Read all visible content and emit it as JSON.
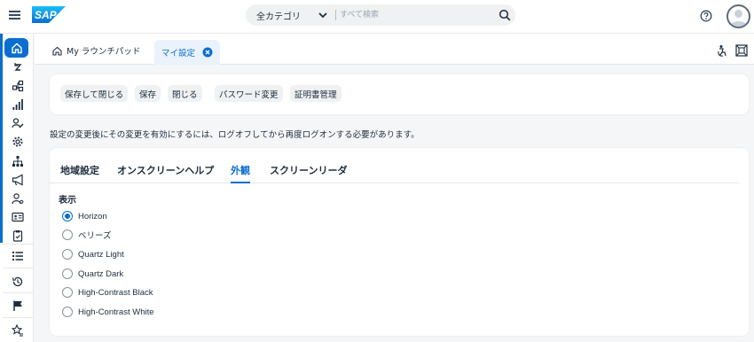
{
  "header": {
    "logo_text": "SAP",
    "search": {
      "category": "全カテゴリ",
      "placeholder": "すべて検索"
    }
  },
  "tabs": {
    "launchpad": "My ラウンチパッド",
    "settings": "マイ設定"
  },
  "toolbar": {
    "save_close": "保存して閉じる",
    "save": "保存",
    "close": "閉じる",
    "change_password": "パスワード変更",
    "cert_mgmt": "証明書管理"
  },
  "notice": "設定の変更後にその変更を有効にするには、ログオフしてから再度ログオンする必要があります。",
  "settings_tabs": [
    "地域設定",
    "オンスクリーンヘルプ",
    "外観",
    "スクリーンリーダ"
  ],
  "selected_tab": "外観",
  "display": {
    "title": "表示",
    "selected": "Horizon",
    "options": [
      "Horizon",
      "ベリーズ",
      "Quartz Light",
      "Quartz Dark",
      "High-Contrast Black",
      "High-Contrast White"
    ]
  },
  "colors": {
    "accent": "#0a6ed1",
    "text": "#1d2d3e",
    "background": "#f5f6f7"
  },
  "rail_icons": [
    "home-icon",
    "refresh-icon",
    "org-chart-icon",
    "bar-chart-icon",
    "edit-user-icon",
    "settings-gear-icon",
    "hierarchy-icon",
    "megaphone-icon",
    "user-settings-icon",
    "id-card-icon",
    "clipboard-icon",
    "list-icon",
    "history-icon",
    "flag-icon",
    "favorites-icon"
  ]
}
